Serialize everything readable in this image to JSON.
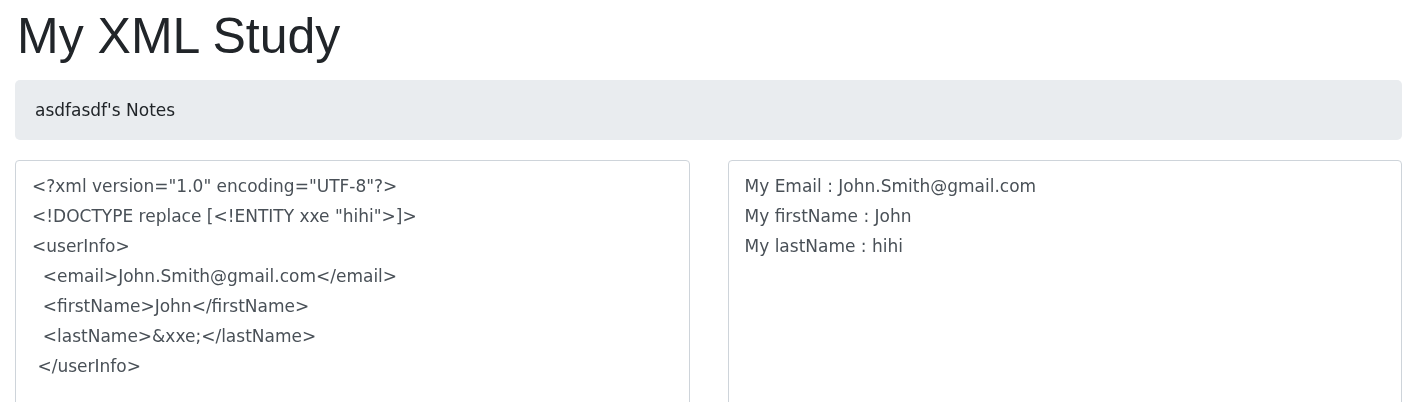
{
  "page_title": "My XML Study",
  "notes_bar": {
    "text": "asdfasdf's Notes"
  },
  "xml_input": {
    "lines": [
      "<?xml version=\"1.0\" encoding=\"UTF-8\"?>",
      "<!DOCTYPE replace [<!ENTITY xxe \"hihi\">]>",
      "<userInfo>",
      "  <email>John.Smith@gmail.com</email>",
      "  <firstName>John</firstName>",
      "  <lastName>&xxe;</lastName>",
      " </userInfo>"
    ]
  },
  "output": {
    "lines": [
      "My Email : John.Smith@gmail.com",
      "My firstName : John",
      "My lastName : hihi"
    ]
  }
}
